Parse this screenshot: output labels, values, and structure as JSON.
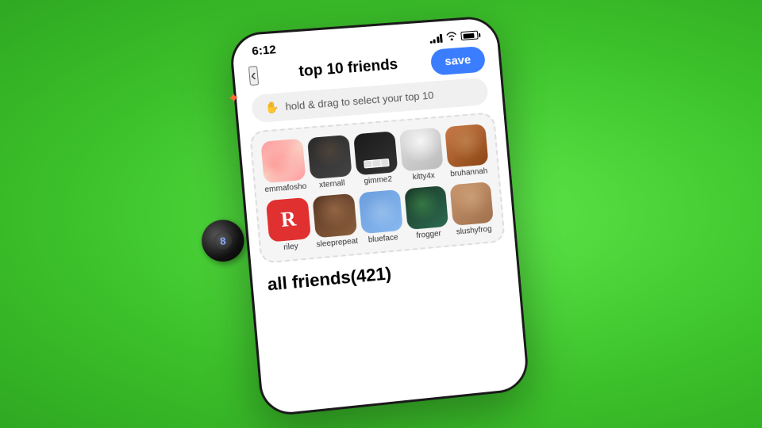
{
  "background": {
    "color": "#4cd137"
  },
  "statusBar": {
    "time": "6:12",
    "signalBars": [
      3,
      6,
      9,
      12
    ],
    "wifi": "wifi",
    "battery": "battery"
  },
  "header": {
    "backLabel": "‹",
    "title": "top 10 friends",
    "saveLabel": "save"
  },
  "instructionBar": {
    "icon": "✋",
    "text": "hold & drag to select your top 10"
  },
  "top10Section": {
    "friends": [
      {
        "id": "emmafosho",
        "name": "emmafosho",
        "avatarClass": "emma-face"
      },
      {
        "id": "xternall",
        "name": "xternall",
        "avatarClass": "xternall-face"
      },
      {
        "id": "gimme2",
        "name": "gimme2",
        "avatarClass": "gimme2-face"
      },
      {
        "id": "kitty4x",
        "name": "kitty4x",
        "avatarClass": "kitty4x-face"
      },
      {
        "id": "bruhannah",
        "name": "bruhannah",
        "avatarClass": "bruhannah-face"
      },
      {
        "id": "riley",
        "name": "riley",
        "avatarClass": "riley-face",
        "isR": true
      },
      {
        "id": "sleeprepeat",
        "name": "sleeprepeat",
        "avatarClass": "sleeprepeat-face"
      },
      {
        "id": "blueface",
        "name": "blueface",
        "avatarClass": "blueface-face"
      },
      {
        "id": "frogger",
        "name": "frogger",
        "avatarClass": "frogger-face"
      },
      {
        "id": "slushyfrog",
        "name": "slushyfrog",
        "avatarClass": "slushyfrog-face"
      }
    ]
  },
  "allFriends": {
    "label": "all friends(421)"
  },
  "magicBall": {
    "symbol": "8"
  },
  "notifStar": {
    "icon": "✦"
  }
}
